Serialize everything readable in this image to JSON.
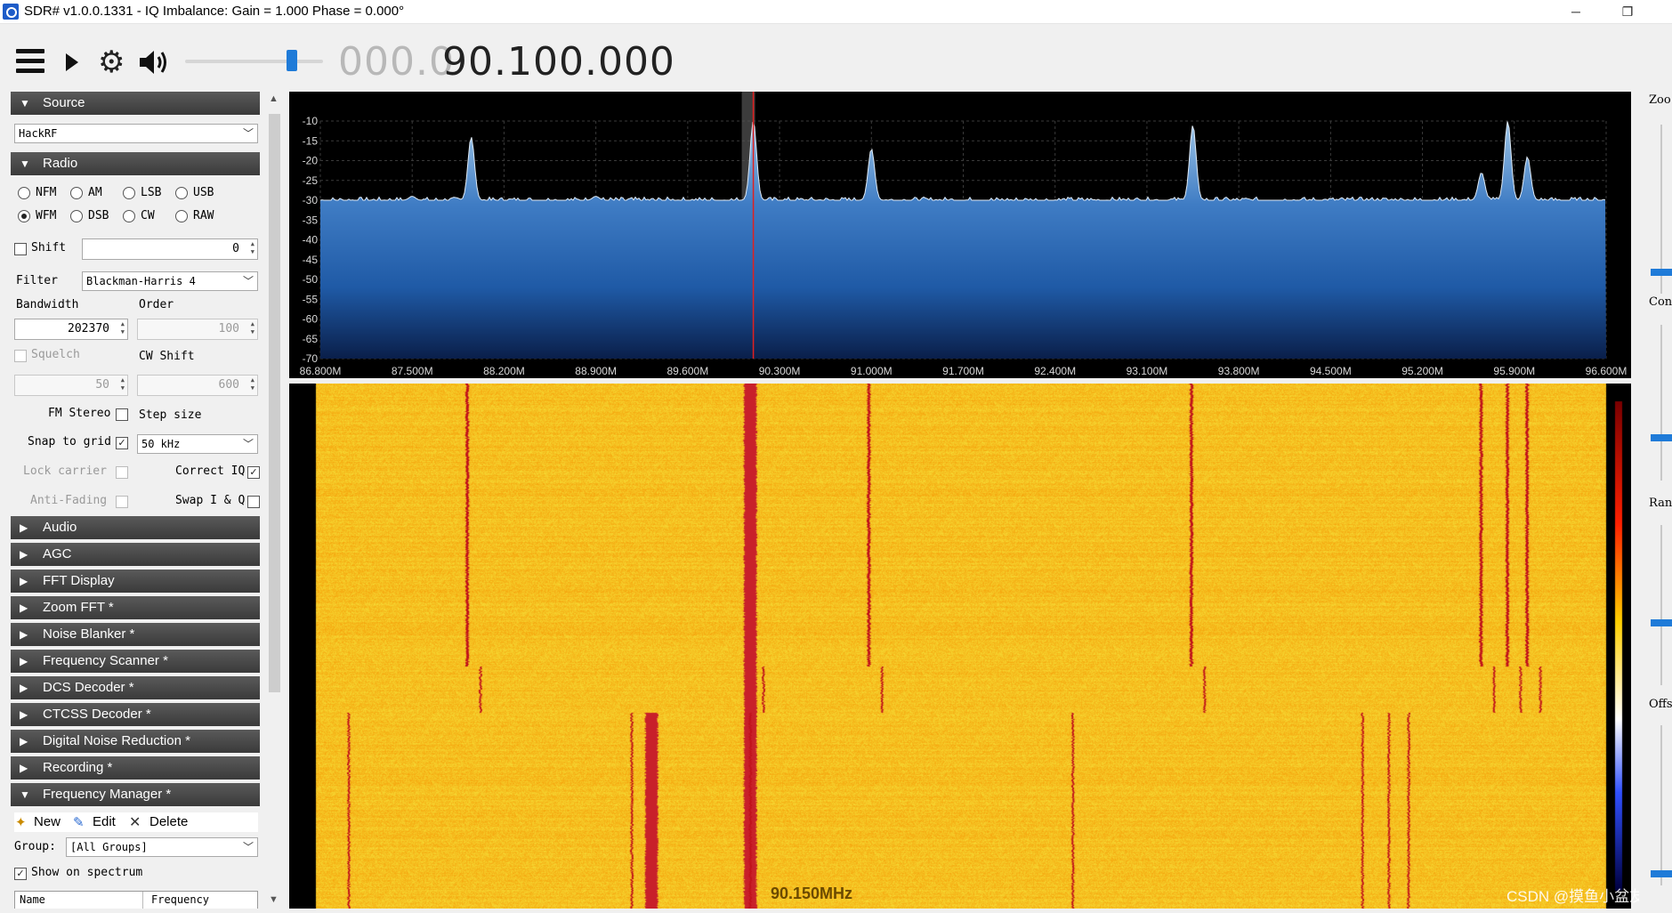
{
  "window": {
    "title": "SDR# v1.0.0.1331 - IQ Imbalance: Gain = 1.000 Phase = 0.000°",
    "minimize": "─",
    "maximize": "❐"
  },
  "toolbar": {
    "frequency_dim": "000.0",
    "frequency_main": "90.100.000",
    "volume_level": 0.85
  },
  "sections": {
    "source": "Source",
    "radio": "Radio",
    "audio": "Audio",
    "agc": "AGC",
    "fft_display": "FFT Display",
    "zoom_fft": "Zoom FFT *",
    "noise_blanker": "Noise Blanker *",
    "frequency_scanner": "Frequency Scanner *",
    "dcs_decoder": "DCS Decoder *",
    "ctcss_decoder": "CTCSS Decoder *",
    "digital_noise_reduction": "Digital Noise Reduction *",
    "recording": "Recording *",
    "frequency_manager": "Frequency Manager *"
  },
  "source": {
    "device": "HackRF"
  },
  "radio": {
    "modes": [
      "NFM",
      "AM",
      "LSB",
      "USB",
      "WFM",
      "DSB",
      "CW",
      "RAW"
    ],
    "selected_mode": "WFM",
    "shift_label": "Shift",
    "shift_value": "0",
    "filter_label": "Filter",
    "filter_value": "Blackman-Harris 4",
    "bandwidth_label": "Bandwidth",
    "bandwidth_value": "202370",
    "order_label": "Order",
    "order_value": "100",
    "squelch_label": "Squelch",
    "squelch_value": "50",
    "cw_shift_label": "CW Shift",
    "cw_shift_value": "600",
    "fm_stereo_label": "FM Stereo",
    "step_size_label": "Step size",
    "snap_label": "Snap to grid",
    "step_size_value": "50 kHz",
    "lock_carrier_label": "Lock carrier",
    "correct_iq_label": "Correct IQ",
    "anti_fading_label": "Anti-Fading",
    "swap_iq_label": "Swap I & Q"
  },
  "freq_manager": {
    "new": "New",
    "edit": "Edit",
    "delete": "Delete",
    "group_label": "Group:",
    "group_value": "[All Groups]",
    "show_on_spectrum": "Show on spectrum",
    "col_name": "Name",
    "col_frequency": "Frequency"
  },
  "right_panel": {
    "zoom": "Zoo",
    "contrast": "Contr",
    "range": "Rang",
    "offset": "Offs"
  },
  "waterfall_label": "90.150MHz",
  "watermark": "CSDN @摸鱼小盆友",
  "chart_data": {
    "type": "line",
    "x_unit": "MHz",
    "x_ticks": [
      "86.800M",
      "87.500M",
      "88.200M",
      "88.900M",
      "89.600M",
      "90.300M",
      "91.000M",
      "91.700M",
      "92.400M",
      "93.100M",
      "93.800M",
      "94.500M",
      "95.200M",
      "95.900M",
      "96.600M"
    ],
    "y_ticks": [
      "-10",
      "-15",
      "-20",
      "-25",
      "-30",
      "-35",
      "-40",
      "-45",
      "-50",
      "-55",
      "-60",
      "-65",
      "-70"
    ],
    "xlim": [
      86.8,
      96.6
    ],
    "ylim": [
      -70,
      -10
    ],
    "noise_floor": -30,
    "center_frequency": 90.1,
    "peaks": [
      {
        "x": 87.5,
        "y": -29
      },
      {
        "x": 87.95,
        "y": -14
      },
      {
        "x": 88.9,
        "y": -29
      },
      {
        "x": 90.1,
        "y": -10
      },
      {
        "x": 91.0,
        "y": -17
      },
      {
        "x": 93.45,
        "y": -11
      },
      {
        "x": 95.65,
        "y": -23
      },
      {
        "x": 95.85,
        "y": -10
      },
      {
        "x": 96.0,
        "y": -19
      }
    ]
  }
}
